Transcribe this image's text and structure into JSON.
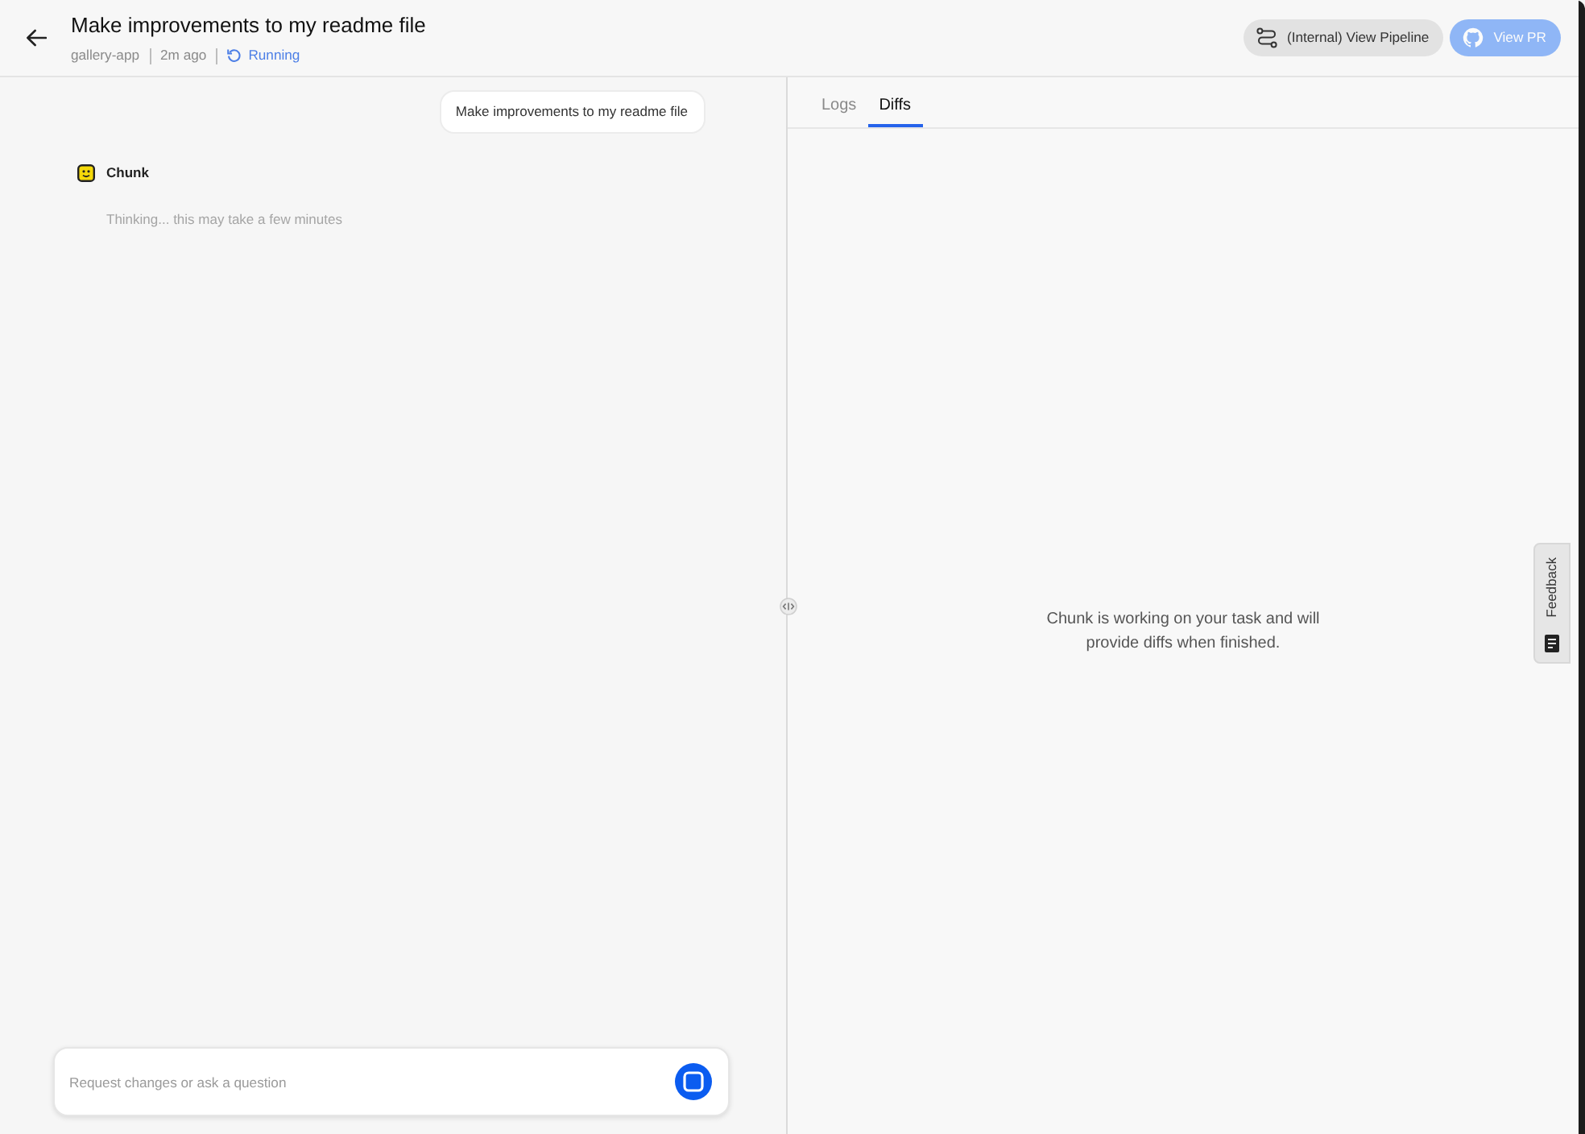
{
  "header": {
    "title": "Make improvements to my readme file",
    "repo": "gallery-app",
    "time": "2m ago",
    "status": "Running",
    "buttons": [
      {
        "label": "(Internal) View Pipeline",
        "kind": "pipeline",
        "disabled": false
      },
      {
        "label": "View PR",
        "kind": "github",
        "disabled": true
      }
    ]
  },
  "chat": {
    "messages": [
      {
        "kind": "user",
        "text": "Make improvements to my readme file"
      },
      {
        "kind": "assistant",
        "author": "Chunk",
        "text": "Thinking... this may take a few minutes"
      }
    ],
    "input": {
      "placeholder": "Request changes or ask a question"
    }
  },
  "tabs": [
    {
      "label": "Logs",
      "selected": false
    },
    {
      "label": "Diffs",
      "selected": true
    }
  ],
  "diffs_panel": {
    "message": "Chunk is working on your task and will provide diffs when finished."
  },
  "feedback_tab": {
    "label": "Feedback"
  }
}
